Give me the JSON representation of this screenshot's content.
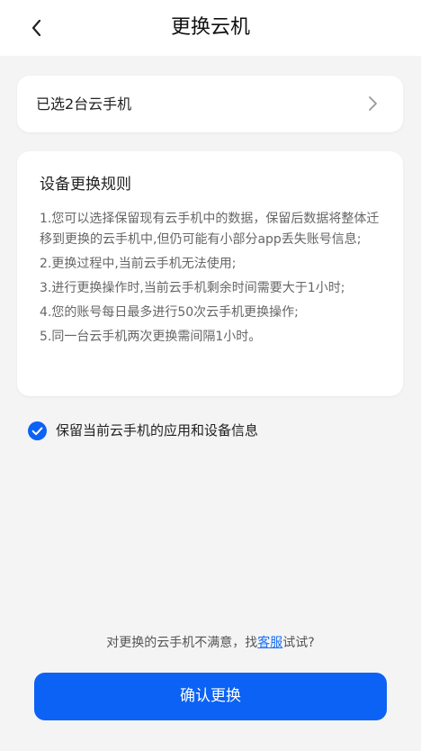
{
  "header": {
    "title": "更换云机",
    "back_icon": "chevron-left-icon"
  },
  "selection": {
    "label": "已选2台云手机",
    "icon": "chevron-right-icon"
  },
  "rules": {
    "title": "设备更换规则",
    "items": [
      "1.您可以选择保留现有云手机中的数据，保留后数据将整体迁移到更换的云手机中,但仍可能有小部分app丢失账号信息;",
      "2.更换过程中,当前云手机无法使用;",
      "3.进行更换操作时,当前云手机剩余时间需要大于1小时;",
      "4.您的账号每日最多进行50次云手机更换操作;",
      "5.同一台云手机两次更换需间隔1小时。"
    ]
  },
  "keep_data": {
    "checked": true,
    "label": "保留当前云手机的应用和设备信息",
    "icon": "check-circle-icon"
  },
  "support": {
    "prefix": "对更换的云手机不满意，找",
    "link": "客服",
    "suffix": "试试?"
  },
  "confirm": {
    "label": "确认更换"
  },
  "colors": {
    "primary": "#0b62f5",
    "link": "#1a6ff5",
    "background": "#f4f4f5",
    "card": "#ffffff"
  }
}
